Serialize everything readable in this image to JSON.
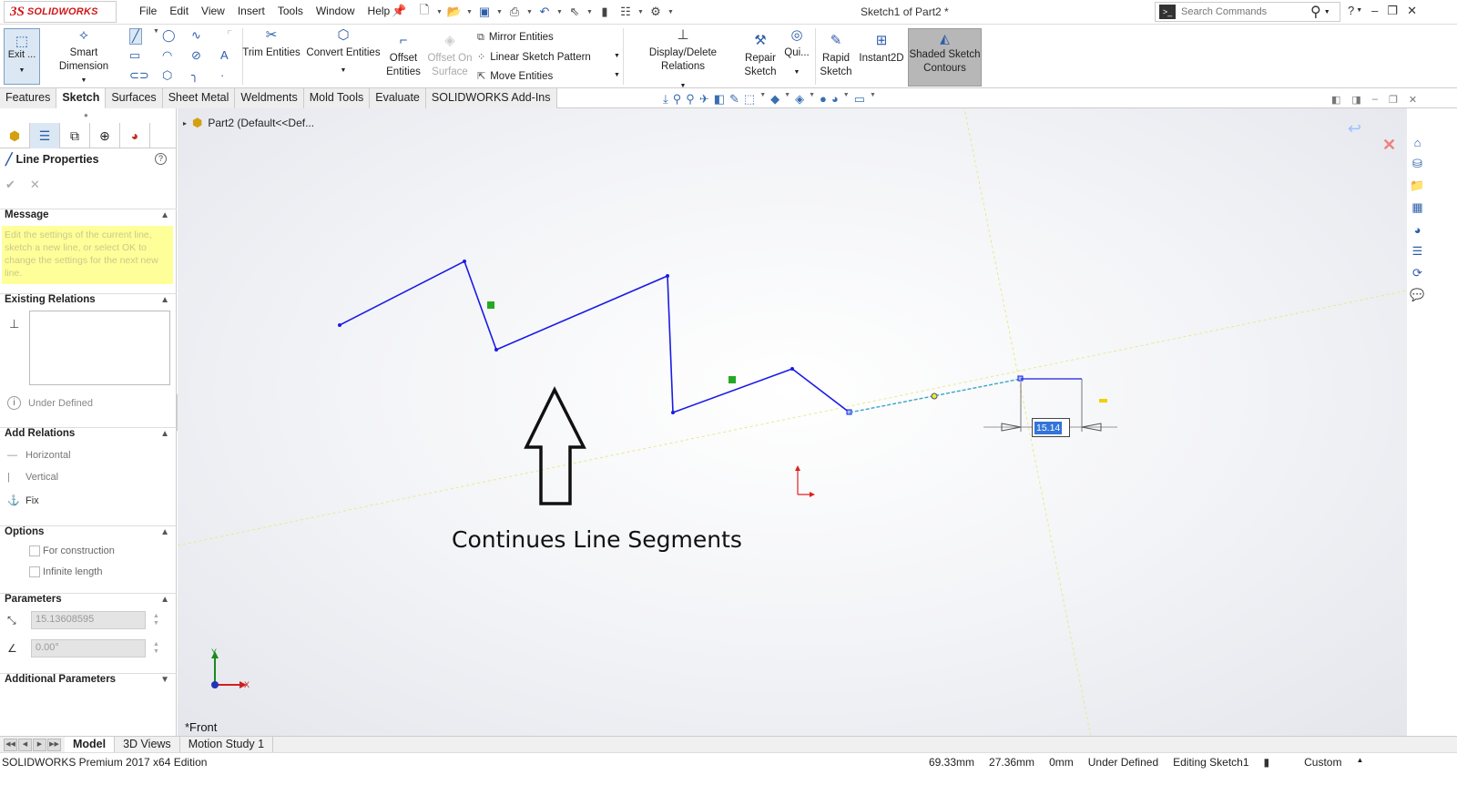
{
  "app": {
    "brand_ds": "3S",
    "brand_name": "SOLIDWORKS",
    "doc_title": "Sketch1 of Part2 *"
  },
  "menu": [
    "File",
    "Edit",
    "View",
    "Insert",
    "Tools",
    "Window",
    "Help"
  ],
  "search": {
    "placeholder": "Search Commands"
  },
  "ribbon": {
    "exit_sketch": "Exit ...",
    "smart_dimension": "Smart Dimension",
    "trim_entities": "Trim Entities",
    "convert_entities": "Convert Entities",
    "offset_entities_1": "Offset",
    "offset_entities_2": "Entities",
    "offset_surface_1": "Offset On",
    "offset_surface_2": "Surface",
    "mirror_entities": "Mirror Entities",
    "linear_pattern": "Linear Sketch Pattern",
    "move_entities": "Move Entities",
    "display_relations": "Display/Delete Relations",
    "repair_sketch_1": "Repair",
    "repair_sketch_2": "Sketch",
    "quick_snaps": "Qui...",
    "rapid_sketch_1": "Rapid",
    "rapid_sketch_2": "Sketch",
    "instant2d": "Instant2D",
    "shaded_1": "Shaded Sketch",
    "shaded_2": "Contours"
  },
  "tabs": [
    "Features",
    "Sketch",
    "Surfaces",
    "Sheet Metal",
    "Weldments",
    "Mold Tools",
    "Evaluate",
    "SOLIDWORKS Add-Ins"
  ],
  "active_tab": "Sketch",
  "property_manager": {
    "title": "Line Properties",
    "message_header": "Message",
    "message_text": "Edit the settings of the current line, sketch a new line, or select OK to change the settings for the next new line.",
    "existing_relations_header": "Existing Relations",
    "status": "Under Defined",
    "add_relations_header": "Add Relations",
    "relations": [
      "Horizontal",
      "Vertical",
      "Fix"
    ],
    "options_header": "Options",
    "options": [
      "For construction",
      "Infinite length"
    ],
    "parameters_header": "Parameters",
    "length_value": "15.13608595",
    "angle_value": "0.00°",
    "additional_parameters_header": "Additional Parameters"
  },
  "graphics": {
    "tree_root": "Part2  (Default<<Def...",
    "caption": "Continues Line Segments",
    "view_name": "*Front",
    "dimension_value": "15.14",
    "axis_y": "Y",
    "axis_x": "X"
  },
  "bottom_tabs": [
    "Model",
    "3D Views",
    "Motion Study 1"
  ],
  "status": {
    "edition": "SOLIDWORKS Premium 2017 x64 Edition",
    "x": "69.33mm",
    "y": "27.36mm",
    "z": "0mm",
    "definition": "Under Defined",
    "editing": "Editing Sketch1",
    "units": "Custom"
  },
  "colors": {
    "sketch_line": "#1a1ae6",
    "brand_red": "#d01818",
    "message_bg": "#ffff99",
    "accent_blue": "#2c5da8"
  }
}
